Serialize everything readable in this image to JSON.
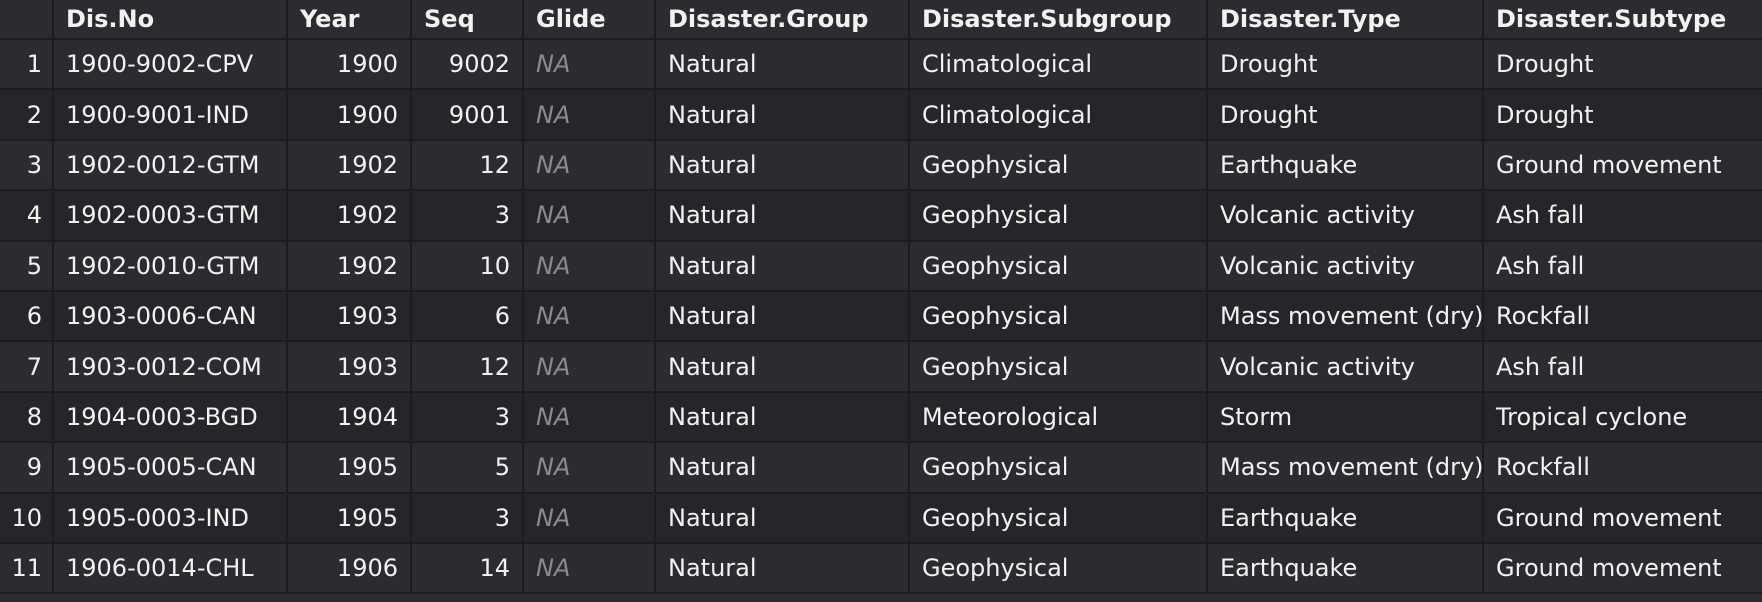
{
  "table": {
    "columns": [
      "",
      "Dis.No",
      "Year",
      "Seq",
      "Glide",
      "Disaster.Group",
      "Disaster.Subgroup",
      "Disaster.Type",
      "Disaster.Subtype"
    ],
    "rows": [
      [
        "1",
        "1900-9002-CPV",
        "1900",
        "9002",
        "NA",
        "Natural",
        "Climatological",
        "Drought",
        "Drought"
      ],
      [
        "2",
        "1900-9001-IND",
        "1900",
        "9001",
        "NA",
        "Natural",
        "Climatological",
        "Drought",
        "Drought"
      ],
      [
        "3",
        "1902-0012-GTM",
        "1902",
        "12",
        "NA",
        "Natural",
        "Geophysical",
        "Earthquake",
        "Ground movement"
      ],
      [
        "4",
        "1902-0003-GTM",
        "1902",
        "3",
        "NA",
        "Natural",
        "Geophysical",
        "Volcanic activity",
        "Ash fall"
      ],
      [
        "5",
        "1902-0010-GTM",
        "1902",
        "10",
        "NA",
        "Natural",
        "Geophysical",
        "Volcanic activity",
        "Ash fall"
      ],
      [
        "6",
        "1903-0006-CAN",
        "1903",
        "6",
        "NA",
        "Natural",
        "Geophysical",
        "Mass movement (dry)",
        "Rockfall"
      ],
      [
        "7",
        "1903-0012-COM",
        "1903",
        "12",
        "NA",
        "Natural",
        "Geophysical",
        "Volcanic activity",
        "Ash fall"
      ],
      [
        "8",
        "1904-0003-BGD",
        "1904",
        "3",
        "NA",
        "Natural",
        "Meteorological",
        "Storm",
        "Tropical cyclone"
      ],
      [
        "9",
        "1905-0005-CAN",
        "1905",
        "5",
        "NA",
        "Natural",
        "Geophysical",
        "Mass movement (dry)",
        "Rockfall"
      ],
      [
        "10",
        "1905-0003-IND",
        "1905",
        "3",
        "NA",
        "Natural",
        "Geophysical",
        "Earthquake",
        "Ground movement"
      ],
      [
        "11",
        "1906-0014-CHL",
        "1906",
        "14",
        "NA",
        "Natural",
        "Geophysical",
        "Earthquake",
        "Ground movement"
      ]
    ]
  }
}
